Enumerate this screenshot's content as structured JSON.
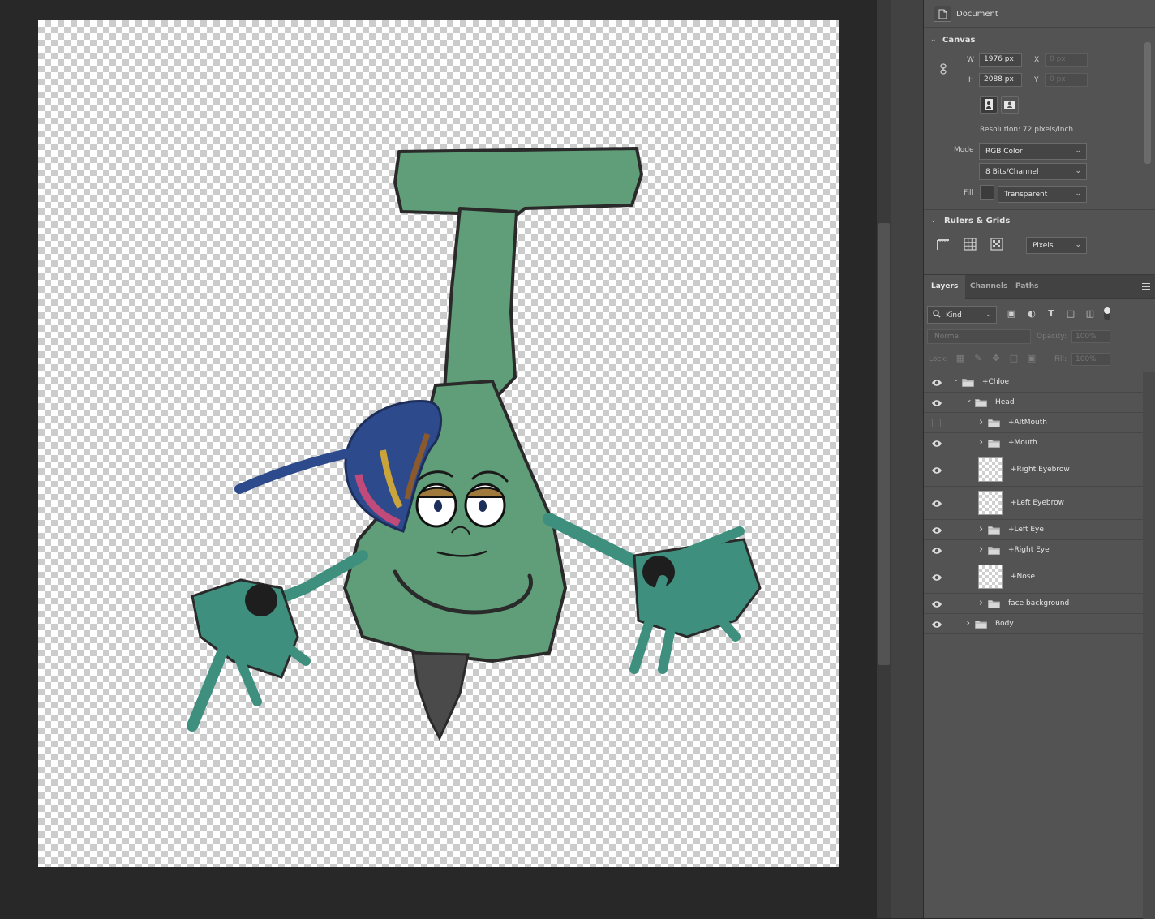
{
  "properties": {
    "document_label": "Document",
    "canvas_section": "Canvas",
    "w_label": "W",
    "h_label": "H",
    "x_label": "X",
    "y_label": "Y",
    "width_value": "1976 px",
    "height_value": "2088 px",
    "x_value": "0 px",
    "y_value": "0 px",
    "resolution": "Resolution: 72 pixels/inch",
    "mode_label": "Mode",
    "mode_value": "RGB Color",
    "bits_value": "8 Bits/Channel",
    "fill_label": "Fill",
    "fill_value": "Transparent",
    "rulers_section": "Rulers & Grids",
    "units_value": "Pixels"
  },
  "layers_panel": {
    "tabs": [
      "Layers",
      "Channels",
      "Paths"
    ],
    "active_tab": "Layers",
    "filter_kind": "Kind",
    "blend_mode": "Normal",
    "opacity_label": "Opacity:",
    "opacity_value": "100%",
    "lock_label": "Lock:",
    "fill_label": "Fill:",
    "fill_value": "100%",
    "layers": [
      {
        "name": "+Chloe",
        "type": "group",
        "visible": true,
        "expanded": true
      },
      {
        "name": "Head",
        "type": "group",
        "visible": true,
        "expanded": true
      },
      {
        "name": "+AltMouth",
        "type": "group",
        "visible": false,
        "expanded": false
      },
      {
        "name": "+Mouth",
        "type": "group",
        "visible": true,
        "expanded": false
      },
      {
        "name": "+Right Eyebrow",
        "type": "layer",
        "visible": true
      },
      {
        "name": "+Left Eyebrow",
        "type": "layer",
        "visible": true
      },
      {
        "name": "+Left Eye",
        "type": "group",
        "visible": true,
        "expanded": false
      },
      {
        "name": "+Right Eye",
        "type": "group",
        "visible": true,
        "expanded": false
      },
      {
        "name": "+Nose",
        "type": "layer",
        "visible": true
      },
      {
        "name": "face background",
        "type": "group",
        "visible": true,
        "expanded": false
      },
      {
        "name": "Body",
        "type": "group",
        "visible": true,
        "expanded": false
      }
    ]
  },
  "colors": {
    "workspace": "#282828",
    "panel": "#535353",
    "character_green": "#5f9e78",
    "hand_teal": "#3f8f7f",
    "outline": "#2a2a2a"
  }
}
